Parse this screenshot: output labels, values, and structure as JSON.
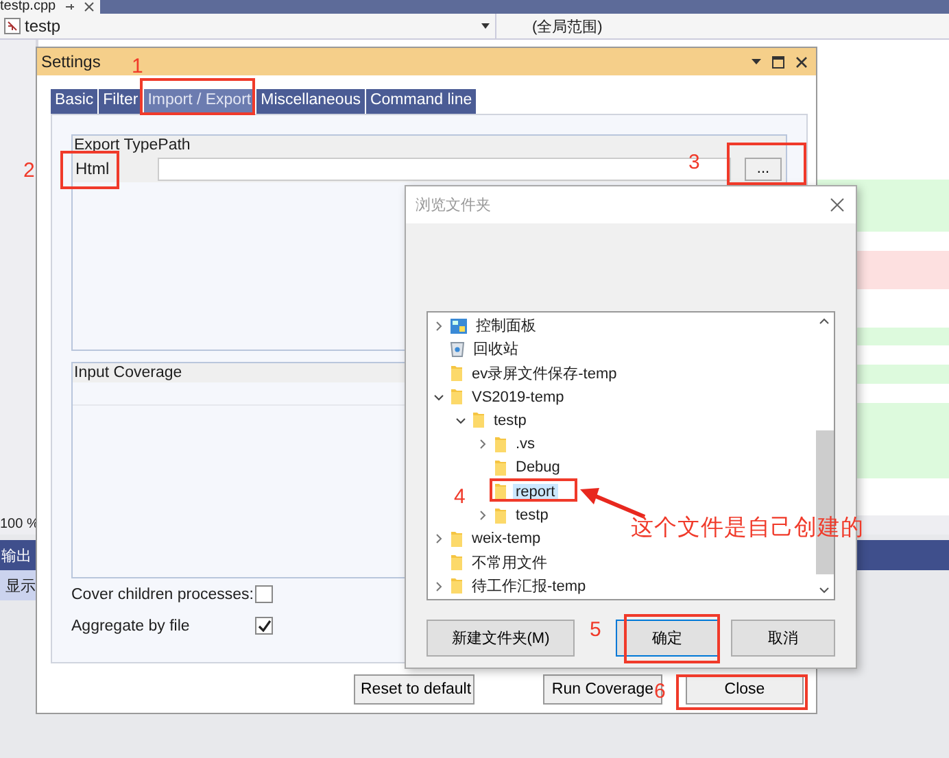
{
  "editor": {
    "file_tab": "testp.cpp",
    "project": "testp",
    "scope": "(全局范围)",
    "zoom_level": "100 %"
  },
  "output_panel": {
    "title": "输出",
    "toolbar_label": "显示"
  },
  "settings": {
    "title": "Settings",
    "tabs": [
      {
        "label": "Basic",
        "selected": false
      },
      {
        "label": "Filter",
        "selected": false
      },
      {
        "label": "Import / Export",
        "selected": true
      },
      {
        "label": "Miscellaneous",
        "selected": false
      },
      {
        "label": "Command line",
        "selected": false
      }
    ],
    "export_group": {
      "header": "Export TypePath",
      "type_label": "Html",
      "browse_button": "..."
    },
    "coverage_group": {
      "header": "Input Coverage"
    },
    "options": [
      {
        "label": "Cover children processes:",
        "checked": false
      },
      {
        "label": "Aggregate by file",
        "checked": true
      }
    ],
    "buttons": [
      "Reset to default",
      "Run Coverage",
      "Close"
    ]
  },
  "folder_dialog": {
    "title": "浏览文件夹",
    "tree": [
      {
        "label": "控制面板",
        "kind": "control-panel",
        "expanded": false,
        "selected": false
      },
      {
        "label": "回收站",
        "kind": "recycle-bin",
        "selected": false
      },
      {
        "label": "ev录屏文件保存-temp",
        "kind": "folder",
        "selected": false
      },
      {
        "label": "VS2019-temp",
        "kind": "folder",
        "expanded": true,
        "selected": false,
        "children": [
          {
            "label": "testp",
            "kind": "folder",
            "expanded": true,
            "selected": false,
            "children": [
              {
                "label": ".vs",
                "kind": "folder",
                "expanded": false,
                "selected": false
              },
              {
                "label": "Debug",
                "kind": "folder",
                "selected": false
              },
              {
                "label": "report",
                "kind": "folder",
                "selected": true
              },
              {
                "label": "testp",
                "kind": "folder",
                "expanded": false,
                "selected": false
              }
            ]
          }
        ]
      },
      {
        "label": "weix-temp",
        "kind": "folder",
        "expanded": false,
        "selected": false
      },
      {
        "label": "不常用文件",
        "kind": "folder",
        "selected": false
      },
      {
        "label": "待工作汇报-temp",
        "kind": "folder",
        "expanded": false,
        "selected": false
      }
    ],
    "buttons": [
      {
        "label": "新建文件夹(M)",
        "focused": false
      },
      {
        "label": "确定",
        "focused": true
      },
      {
        "label": "取消",
        "focused": false
      }
    ]
  },
  "annotations": {
    "markers": [
      "1",
      "2",
      "3",
      "4",
      "5",
      "6"
    ],
    "note": "这个文件是自己创建的"
  }
}
